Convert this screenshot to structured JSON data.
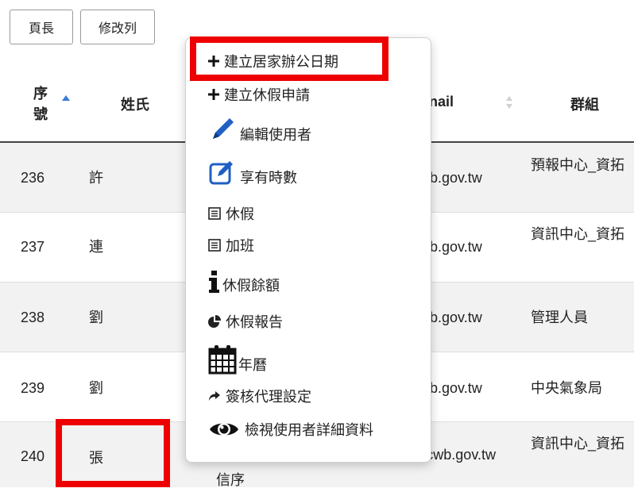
{
  "toolbar": {
    "page_length": "頁長",
    "edit_columns": "修改列"
  },
  "table": {
    "headers": {
      "id_line1": "序",
      "id_line2": "號",
      "name": "姓氏",
      "email": "nail",
      "group": "群組"
    },
    "rows": [
      {
        "id": "236",
        "name": "許",
        "email": "wb.gov.tw",
        "group": "預報中心_資拓"
      },
      {
        "id": "237",
        "name": "連",
        "email": "wb.gov.tw",
        "group": "資訊中心_資拓"
      },
      {
        "id": "238",
        "name": "劉",
        "email": "wb.gov.tw",
        "group": "管理人員"
      },
      {
        "id": "239",
        "name": "劉",
        "email": "wb.gov.tw",
        "group": "中央氣象局"
      },
      {
        "id": "240",
        "name": "張",
        "given_partial": "信序",
        "email": "jamus@cwb.gov.tw",
        "group": "資訊中心_資拓"
      }
    ]
  },
  "context_menu": {
    "items": [
      {
        "label": "建立居家辦公日期",
        "icon": "plus-icon"
      },
      {
        "label": "建立休假申請",
        "icon": "plus-icon"
      },
      {
        "label": "編輯使用者",
        "icon": "pencil-icon"
      },
      {
        "label": "享有時數",
        "icon": "edit-square-icon"
      },
      {
        "label": "休假",
        "icon": "list-icon"
      },
      {
        "label": "加班",
        "icon": "list-icon"
      },
      {
        "label": "休假餘額",
        "icon": "info-icon"
      },
      {
        "label": "休假報告",
        "icon": "pie-chart-icon"
      },
      {
        "label": "年曆",
        "icon": "calendar-icon"
      },
      {
        "label": "簽核代理設定",
        "icon": "share-arrow-icon"
      },
      {
        "label": "檢視使用者詳細資料",
        "icon": "eye-icon"
      }
    ]
  },
  "colors": {
    "highlight": "#ee0000",
    "sort_active": "#3a7bd5",
    "row_stripe": "#f2f2f2"
  }
}
